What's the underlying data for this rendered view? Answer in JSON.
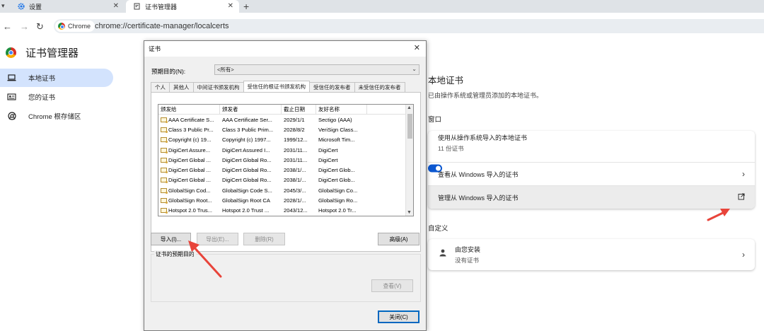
{
  "tabs": [
    {
      "label": "设置",
      "icon": "gear-icon"
    },
    {
      "label": "证书管理器",
      "icon": "certificate-icon"
    }
  ],
  "toolbar": {
    "chip_label": "Chrome",
    "url": "chrome://certificate-manager/localcerts"
  },
  "sidebar": {
    "title": "证书管理器",
    "items": [
      {
        "label": "本地证书",
        "icon": "laptop-icon"
      },
      {
        "label": "您的证书",
        "icon": "id-card-icon"
      },
      {
        "label": "Chrome 根存储区",
        "icon": "chrome-icon"
      }
    ]
  },
  "main": {
    "title": "本地证书",
    "description": "已由操作系统或管理员添加的本地证书。",
    "windows_group_label": "窗口",
    "windows_rows": [
      {
        "label": "使用从操作系统导入的本地证书",
        "sub": "11 份证书",
        "toggle_on": true
      },
      {
        "label": "查看从 Windows 导入的证书"
      },
      {
        "label": "管理从 Windows 导入的证书"
      }
    ],
    "custom_group_label": "自定义",
    "custom_row": {
      "label": "由您安装",
      "sub": "没有证书"
    }
  },
  "dialog": {
    "title": "证书",
    "purpose_label": "预期目的(N):",
    "purpose_value": "<所有>",
    "tabs": [
      "个人",
      "其他人",
      "中间证书颁发机构",
      "受信任的根证书颁发机构",
      "受信任的发布者",
      "未受信任的发布者"
    ],
    "columns": [
      "颁发给",
      "颁发者",
      "截止日期",
      "友好名称"
    ],
    "rows": [
      [
        "AAA Certificate S...",
        "AAA Certificate Ser...",
        "2029/1/1",
        "Sectigo (AAA)"
      ],
      [
        "Class 3 Public Pr...",
        "Class 3 Public Prim...",
        "2028/8/2",
        "VeriSign Class..."
      ],
      [
        "Copyright (c) 19...",
        "Copyright (c) 1997...",
        "1999/12...",
        "Microsoft Tim..."
      ],
      [
        "DigiCert Assure...",
        "DigiCert Assured I...",
        "2031/11...",
        "DigiCert"
      ],
      [
        "DigiCert Global ...",
        "DigiCert Global Ro...",
        "2031/11...",
        "DigiCert"
      ],
      [
        "DigiCert Global ...",
        "DigiCert Global Ro...",
        "2038/1/...",
        "DigiCert Glob..."
      ],
      [
        "DigiCert Global ...",
        "DigiCert Global Ro...",
        "2038/1/...",
        "DigiCert Glob..."
      ],
      [
        "GlobalSign Cod...",
        "GlobalSign Code S...",
        "2045/3/...",
        "GlobalSign Co..."
      ],
      [
        "GlobalSign Root...",
        "GlobalSign Root CA",
        "2028/1/...",
        "GlobalSign Ro..."
      ],
      [
        "Hotspot 2.0 Trus...",
        "Hotspot 2.0 Trust ...",
        "2043/12...",
        "Hotspot 2.0 Tr..."
      ]
    ],
    "buttons": {
      "import": "导入(I)...",
      "export": "导出(E)...",
      "remove": "删除(R)",
      "advanced": "高级(A)",
      "view": "查看(V)",
      "close": "关闭(C)"
    },
    "purpose_group_label": "证书的预期目的"
  },
  "colors": {
    "accent": "#0b57d0",
    "sidebar_active": "#d3e3fd",
    "arrow": "#e8443a"
  }
}
